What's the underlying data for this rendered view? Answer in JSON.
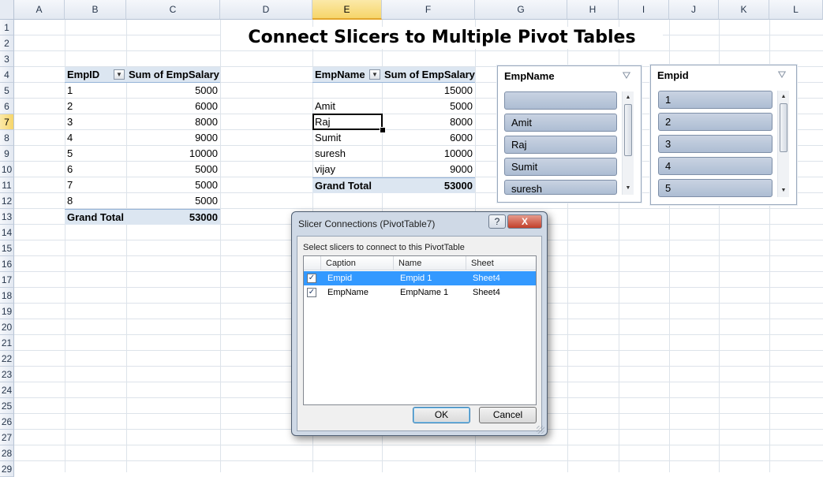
{
  "title": "Connect Slicers to Multiple Pivot Tables",
  "columns": [
    "A",
    "B",
    "C",
    "D",
    "E",
    "F",
    "G",
    "H",
    "I",
    "J",
    "K",
    "L"
  ],
  "rows": [
    "1",
    "2",
    "3",
    "4",
    "5",
    "6",
    "7",
    "8",
    "9",
    "10",
    "11",
    "12",
    "13",
    "14",
    "15",
    "16",
    "17",
    "18",
    "19",
    "20",
    "21",
    "22",
    "23",
    "24",
    "25",
    "26",
    "27",
    "28",
    "29"
  ],
  "selected_column": "E",
  "selected_row": "7",
  "pivot1": {
    "header_id": "EmpID",
    "header_sum": "Sum of EmpSalary",
    "rows": [
      {
        "id": "1",
        "sal": "5000"
      },
      {
        "id": "2",
        "sal": "6000"
      },
      {
        "id": "3",
        "sal": "8000"
      },
      {
        "id": "4",
        "sal": "9000"
      },
      {
        "id": "5",
        "sal": "10000"
      },
      {
        "id": "6",
        "sal": "5000"
      },
      {
        "id": "7",
        "sal": "5000"
      },
      {
        "id": "8",
        "sal": "5000"
      }
    ],
    "total_label": "Grand Total",
    "total_value": "53000"
  },
  "pivot2": {
    "header_name": "EmpName",
    "header_sum": "Sum of EmpSalary",
    "rows": [
      {
        "name": "",
        "sal": "15000"
      },
      {
        "name": "Amit",
        "sal": "5000"
      },
      {
        "name": "Raj",
        "sal": "8000"
      },
      {
        "name": "Sumit",
        "sal": "6000"
      },
      {
        "name": "suresh",
        "sal": "10000"
      },
      {
        "name": "vijay",
        "sal": "9000"
      }
    ],
    "total_label": "Grand Total",
    "total_value": "53000"
  },
  "slicer_empname": {
    "header": "EmpName",
    "clear_icon": "clear-filter-icon",
    "items": [
      "",
      "Amit",
      "Raj",
      "Sumit",
      "suresh"
    ]
  },
  "slicer_empid": {
    "header": "Empid",
    "clear_icon": "clear-filter-icon",
    "items": [
      "1",
      "2",
      "3",
      "4",
      "5"
    ]
  },
  "dialog": {
    "title": "Slicer Connections (PivotTable7)",
    "help_label": "?",
    "close_label": "X",
    "instruction": "Select slicers to connect to this PivotTable",
    "columns": [
      "Caption",
      "Name",
      "Sheet"
    ],
    "rows": [
      {
        "caption": "Empid",
        "name": "Empid 1",
        "sheet": "Sheet4",
        "checked": "✓"
      },
      {
        "caption": "EmpName",
        "name": "EmpName 1",
        "sheet": "Sheet4",
        "checked": "✓"
      }
    ],
    "ok_label": "OK",
    "cancel_label": "Cancel"
  },
  "colors": {
    "pivot_header": "#dce6f1",
    "slicer_item": "#b8c6da",
    "selection": "#3399ff",
    "close_button": "#c2402a"
  }
}
